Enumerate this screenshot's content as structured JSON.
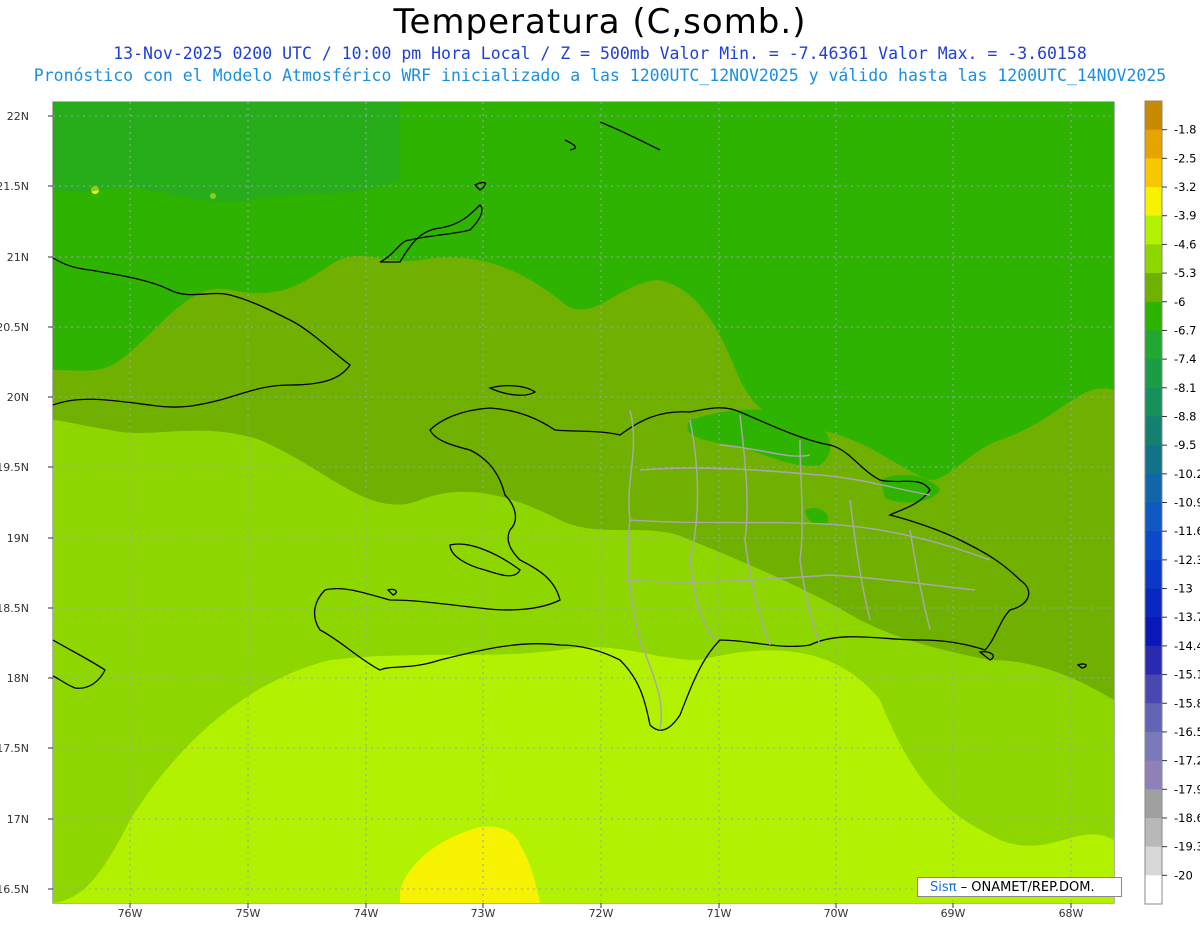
{
  "header": {
    "title": "Temperatura (C,somb.)",
    "line1": "13-Nov-2025  0200 UTC / 10:00 pm Hora Local / Z = 500mb  Valor Min. = -7.46361  Valor Max. = -3.60158",
    "line2": "Pronóstico con el Modelo Atmosférico WRF inicializado a las 1200UTC_12NOV2025 y válido hasta las  1200UTC_14NOV2025"
  },
  "axes": {
    "lat_labels": [
      "22N",
      "21.5N",
      "21N",
      "20.5N",
      "20N",
      "19.5N",
      "19N",
      "18.5N",
      "18N",
      "17.5N",
      "17N",
      "16.5N"
    ],
    "lon_labels": [
      "76W",
      "75W",
      "74W",
      "73W",
      "72W",
      "71W",
      "70W",
      "69W",
      "68W"
    ]
  },
  "colorbar": {
    "labels": [
      "-1.8",
      "-2.5",
      "-3.2",
      "-3.9",
      "-4.6",
      "-5.3",
      "-6",
      "-6.7",
      "-7.4",
      "-8.1",
      "-8.8",
      "-9.5",
      "-10.2",
      "-10.9",
      "-11.6",
      "-12.3",
      "-13",
      "-13.7",
      "-14.4",
      "-15.1",
      "-15.8",
      "-16.5",
      "-17.2",
      "-17.9",
      "-18.6",
      "-19.3",
      "-20"
    ],
    "colors": [
      "#c88a00",
      "#e6a400",
      "#f7c800",
      "#f7f200",
      "#b2f200",
      "#8ed600",
      "#6fb000",
      "#2db300",
      "#22a832",
      "#1d9c48",
      "#18905c",
      "#168070",
      "#127388",
      "#1066a8",
      "#0e58c0",
      "#0c48c8",
      "#0a38c8",
      "#0a28c0",
      "#0a18b8",
      "#2a2ab0",
      "#4848b0",
      "#6464b4",
      "#7a7ab8",
      "#9080b8",
      "#a0a0a0",
      "#b8b8b8",
      "#d8d8d8",
      "#ffffff"
    ]
  },
  "credit": {
    "logo": "Sisπ",
    "text": " – ONAMET/REP.DOM."
  }
}
